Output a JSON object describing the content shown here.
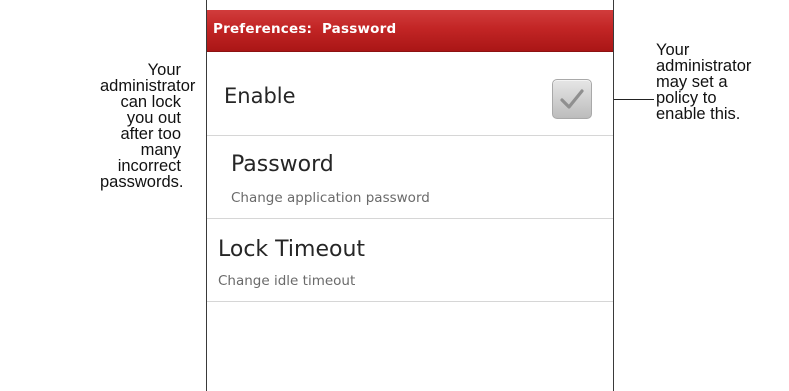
{
  "annotations": {
    "left_lines": [
      "Your administrator",
      "can lock you out",
      "after too many",
      "incorrect",
      "passwords."
    ],
    "right_lines": [
      "Your",
      "administrator",
      "may set a",
      "policy to",
      "enable this."
    ]
  },
  "screen": {
    "title": "Preferences:  Password",
    "accent_color": "#c22525",
    "items": [
      {
        "title": "Enable",
        "summary": "",
        "checkbox": {
          "checked": true,
          "icon": "checkmark-icon"
        }
      },
      {
        "title": "Password",
        "summary": "Change application password"
      },
      {
        "title": "Lock Timeout",
        "summary": "Change idle timeout"
      }
    ]
  }
}
